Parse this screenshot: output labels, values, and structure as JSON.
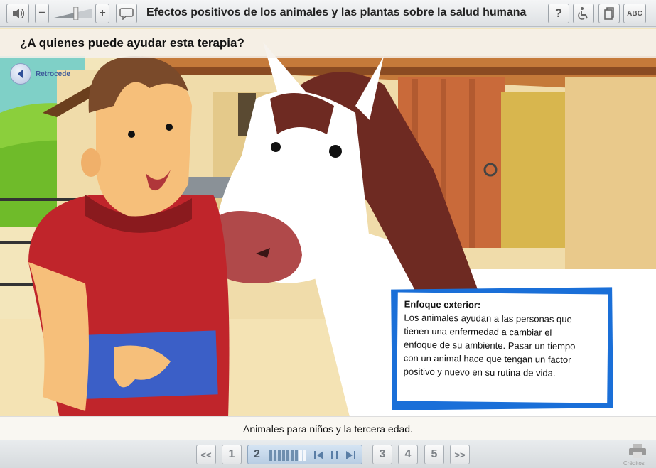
{
  "toolbar": {
    "title": "Efectos positivos de los animales y las plantas sobre la salud humana",
    "volume_level": 0.6,
    "minus_label": "−",
    "plus_label": "+",
    "help_label": "?",
    "abc_label": "ABC",
    "icons": [
      "speaker-icon",
      "speech-bubble-icon",
      "accessibility-icon",
      "copy-icon"
    ]
  },
  "scene": {
    "question": "¿A quienes puede ayudar esta terapia?",
    "back_label": "Retrocede",
    "info_heading": "Enfoque exterior:",
    "info_lines": [
      "Los animales ayudan a las personas que",
      "tienen una enfermedad a cambiar el",
      "enfoque de su ambiente. Pasar un tiempo",
      "con un animal hace que tengan un factor",
      "positivo y nuevo en su rutina de vida."
    ],
    "caption": "Animales para niños y la tercera edad."
  },
  "navigation": {
    "prev_label": "<<",
    "next_label": ">>",
    "pages": [
      "1",
      "3",
      "4",
      "5"
    ],
    "current_page": "2",
    "progress_filled": 7,
    "progress_total": 9,
    "credits_label": "Créditos"
  },
  "colors": {
    "accent": "#1a6fd8",
    "shirt": "#c0252b",
    "barn": "#c96a3a"
  }
}
